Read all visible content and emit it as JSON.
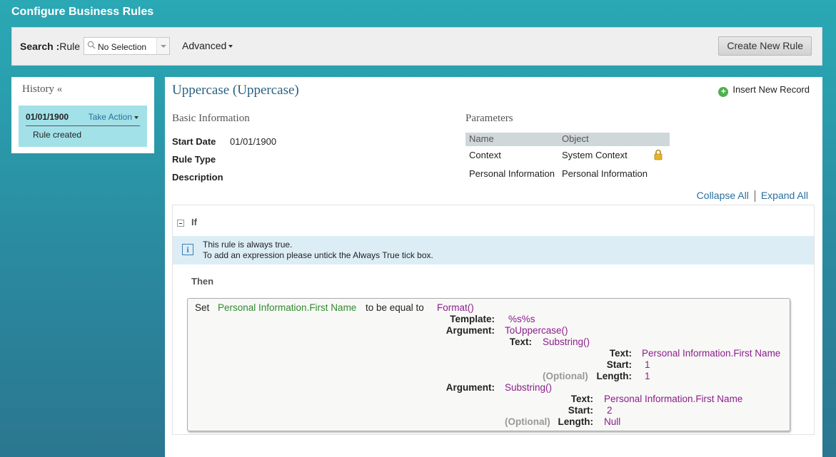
{
  "app": {
    "title": "Configure Business Rules"
  },
  "search": {
    "label": "Search :",
    "scope": "Rule",
    "selected": "No Selection",
    "advanced_label": "Advanced",
    "create_button": "Create New Rule"
  },
  "history": {
    "title": "History «",
    "items": [
      {
        "date": "01/01/1900",
        "action": "Take Action",
        "text": "Rule created"
      }
    ]
  },
  "rule": {
    "title": "Uppercase (Uppercase)",
    "insert_label": "Insert New Record",
    "basic_info_title": "Basic Information",
    "fields": [
      {
        "label": "Start Date",
        "value": "01/01/1900"
      },
      {
        "label": "Rule Type",
        "value": ""
      },
      {
        "label": "Description",
        "value": ""
      }
    ],
    "parameters_title": "Parameters",
    "parameters": {
      "headers": [
        "Name",
        "Object"
      ],
      "rows": [
        {
          "name": "Context",
          "object": "System Context",
          "locked": true
        },
        {
          "name": "Personal Information",
          "object": "Personal Information",
          "locked": false
        }
      ]
    },
    "collapse_all": "Collapse All",
    "expand_all": "Expand All",
    "if_label": "If",
    "info_line1": "This rule is always true.",
    "info_line2": "To add an expression please untick the Always True tick box.",
    "then_label": "Then",
    "expression": {
      "set": "Set",
      "target": "Personal Information.First Name",
      "equal": "to be equal to",
      "func": "Format()",
      "template_label": "Template:",
      "template_value": "%s%s",
      "argument_label": "Argument:",
      "arg1_value": "ToUppercase()",
      "text_label": "Text:",
      "arg1_text_value": "Substring()",
      "inner_text_value": "Personal Information.First Name",
      "start_label": "Start:",
      "inner_start_value": "1",
      "optional": "(Optional)",
      "length_label": "Length:",
      "inner_length_value": "1",
      "arg2_value": "Substring()",
      "arg2_text_value": "Personal Information.First Name",
      "arg2_start_value": "2",
      "arg2_length_value": "Null"
    }
  }
}
